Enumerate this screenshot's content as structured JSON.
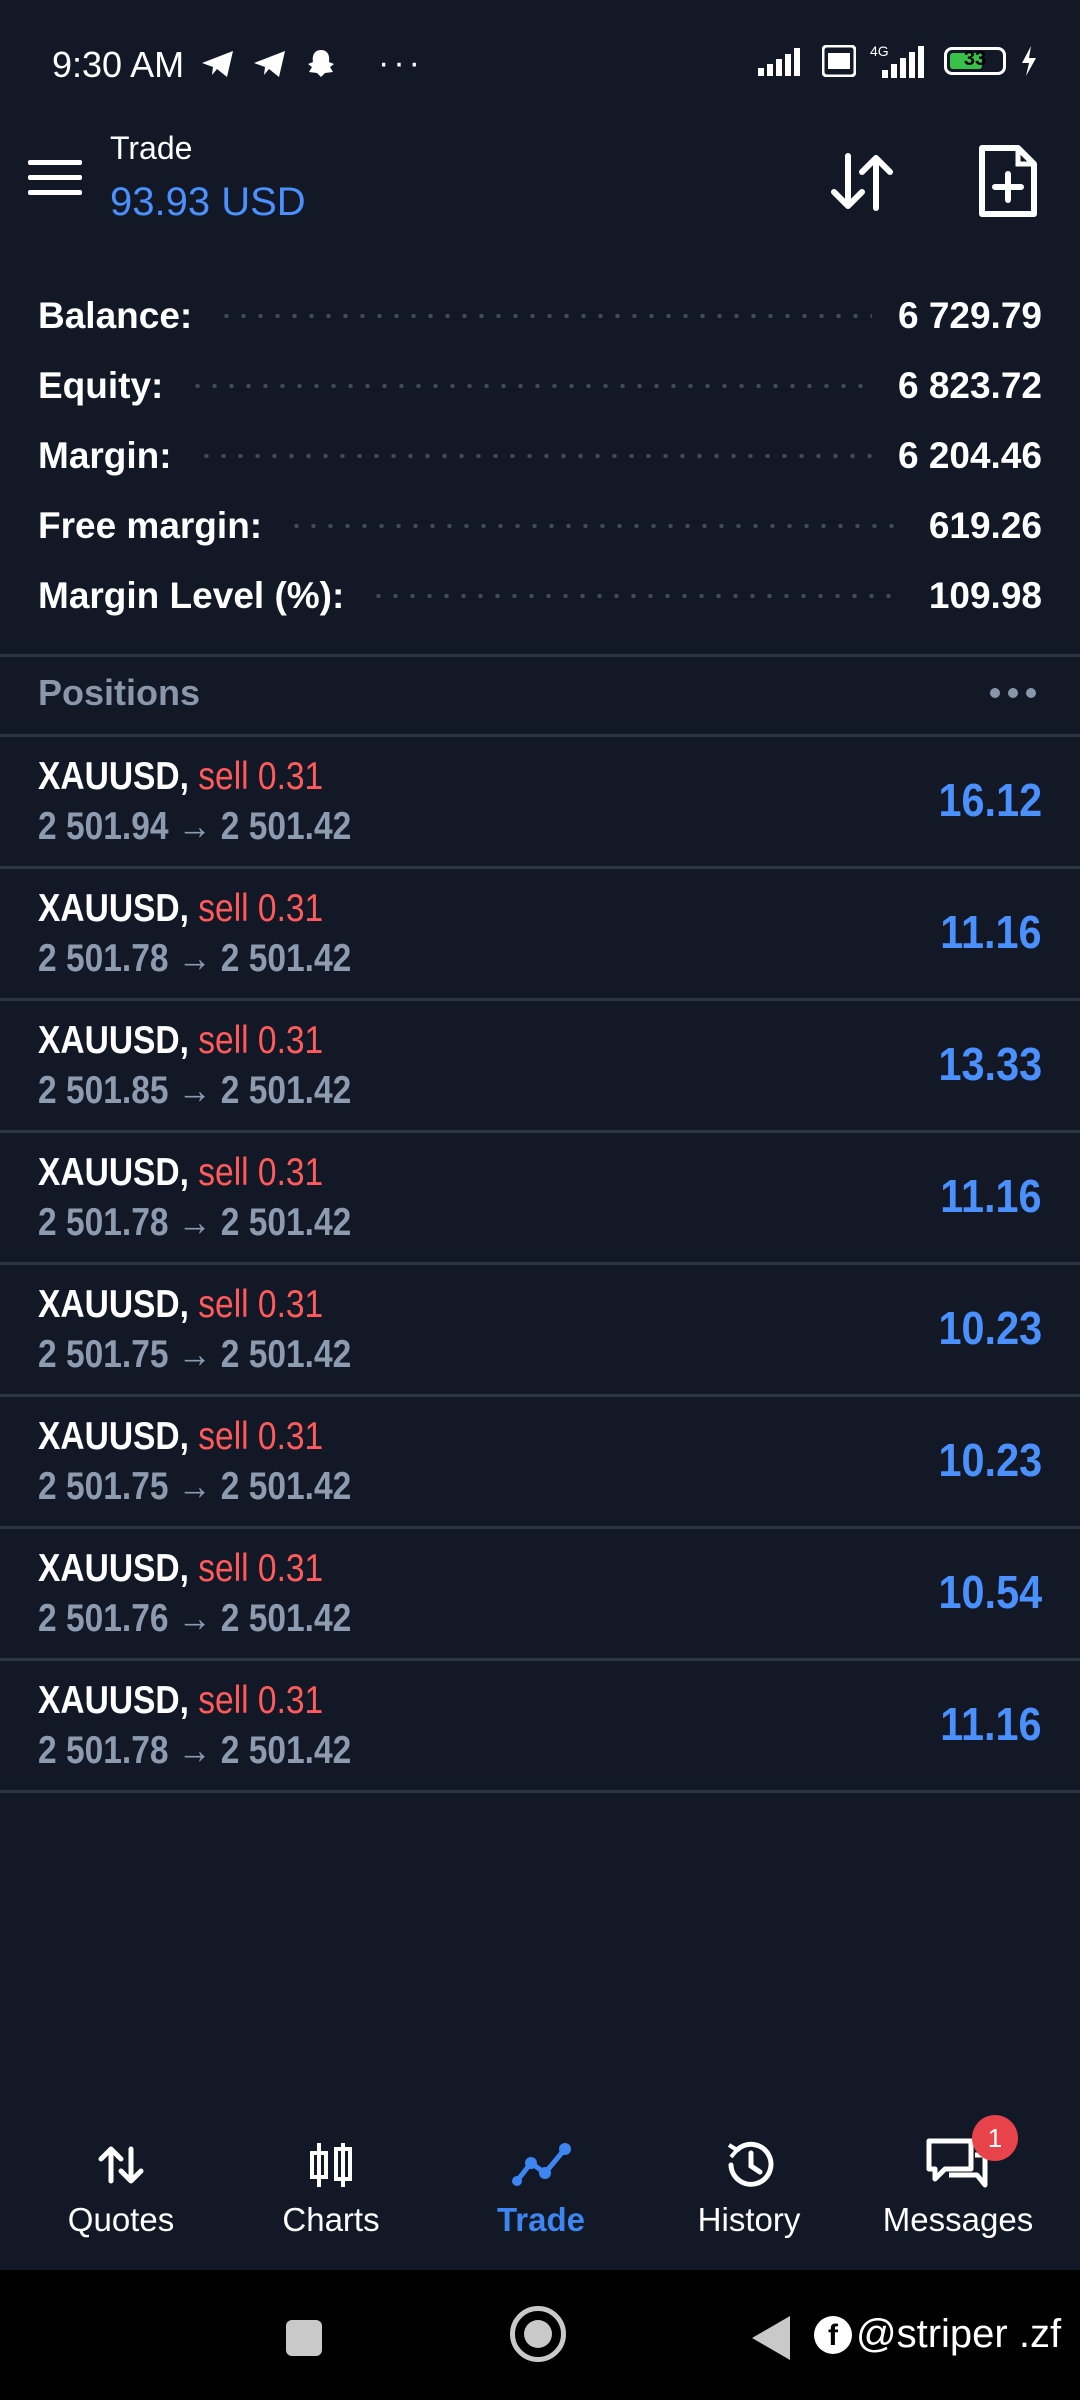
{
  "status_bar": {
    "time": "9:30 AM",
    "dots": "···",
    "battery": "33"
  },
  "header": {
    "title": "Trade",
    "value": "93.93 USD"
  },
  "account": [
    {
      "label": "Balance:",
      "value": "6 729.79"
    },
    {
      "label": "Equity:",
      "value": "6 823.72"
    },
    {
      "label": "Margin:",
      "value": "6 204.46"
    },
    {
      "label": "Free margin:",
      "value": "619.26"
    },
    {
      "label": "Margin Level (%):",
      "value": "109.98"
    }
  ],
  "positions": {
    "title": "Positions",
    "items": [
      {
        "symbol": "XAUUSD,",
        "side": "sell 0.31",
        "prices": "2 501.94 → 2 501.42",
        "profit": "16.12"
      },
      {
        "symbol": "XAUUSD,",
        "side": "sell 0.31",
        "prices": "2 501.78 → 2 501.42",
        "profit": "11.16"
      },
      {
        "symbol": "XAUUSD,",
        "side": "sell 0.31",
        "prices": "2 501.85 → 2 501.42",
        "profit": "13.33"
      },
      {
        "symbol": "XAUUSD,",
        "side": "sell 0.31",
        "prices": "2 501.78 → 2 501.42",
        "profit": "11.16"
      },
      {
        "symbol": "XAUUSD,",
        "side": "sell 0.31",
        "prices": "2 501.75 → 2 501.42",
        "profit": "10.23"
      },
      {
        "symbol": "XAUUSD,",
        "side": "sell 0.31",
        "prices": "2 501.75 → 2 501.42",
        "profit": "10.23"
      },
      {
        "symbol": "XAUUSD,",
        "side": "sell 0.31",
        "prices": "2 501.76 → 2 501.42",
        "profit": "10.54"
      },
      {
        "symbol": "XAUUSD,",
        "side": "sell 0.31",
        "prices": "2 501.78 → 2 501.42",
        "profit": "11.16"
      }
    ]
  },
  "bottom_nav": {
    "items": [
      {
        "label": "Quotes",
        "icon": "arrows-updown-icon"
      },
      {
        "label": "Charts",
        "icon": "candlestick-icon"
      },
      {
        "label": "Trade",
        "icon": "trend-icon",
        "active": true
      },
      {
        "label": "History",
        "icon": "history-icon"
      },
      {
        "label": "Messages",
        "icon": "chat-icon"
      }
    ],
    "messages_badge": "1"
  },
  "watermark": "@striper .zf",
  "colors": {
    "background": "#121826",
    "accent": "#4a90ff",
    "sell": "#ff5b5b",
    "muted": "#8d9bb0"
  }
}
